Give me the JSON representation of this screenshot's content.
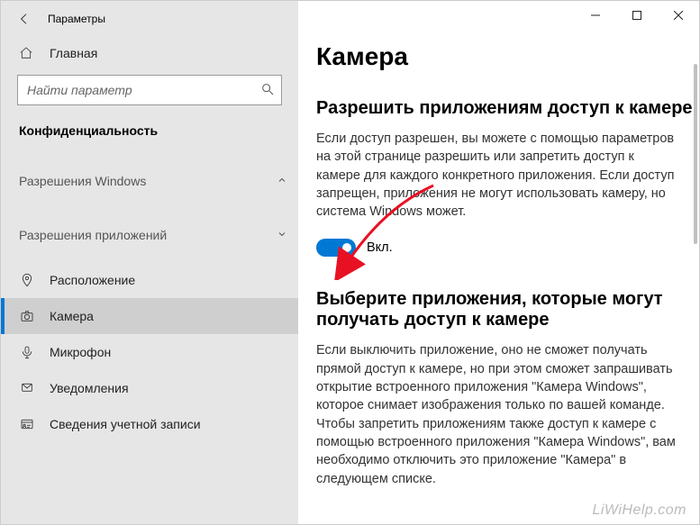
{
  "window_title": "Параметры",
  "home_label": "Главная",
  "search_placeholder": "Найти параметр",
  "section_title": "Конфиденциальность",
  "group1": "Разрешения Windows",
  "group2": "Разрешения приложений",
  "nav": {
    "location": "Расположение",
    "camera": "Камера",
    "microphone": "Микрофон",
    "notifications": "Уведомления",
    "account_info": "Сведения учетной записи"
  },
  "page_title": "Камера",
  "section_allow_title": "Разрешить приложениям доступ к камере",
  "section_allow_body": "Если доступ разрешен, вы можете с помощью параметров на этой странице разрешить или запретить доступ к камере для каждого конкретного приложения. Если доступ запрещен, приложения не могут использовать камеру, но система Windows может.",
  "toggle_label": "Вкл.",
  "section_choose_title": "Выберите приложения, которые могут получать доступ к камере",
  "section_choose_body": "Если выключить приложение, оно не сможет получать прямой доступ к камере, но при этом сможет запрашивать открытие встроенного приложения \"Камера Windows\", которое снимает изображения только по вашей команде. Чтобы запретить приложениям также доступ к камере с помощью встроенного приложения \"Камера Windows\", вам необходимо отключить это приложение \"Камера\" в следующем списке.",
  "watermark": "LiWiHelp.com"
}
